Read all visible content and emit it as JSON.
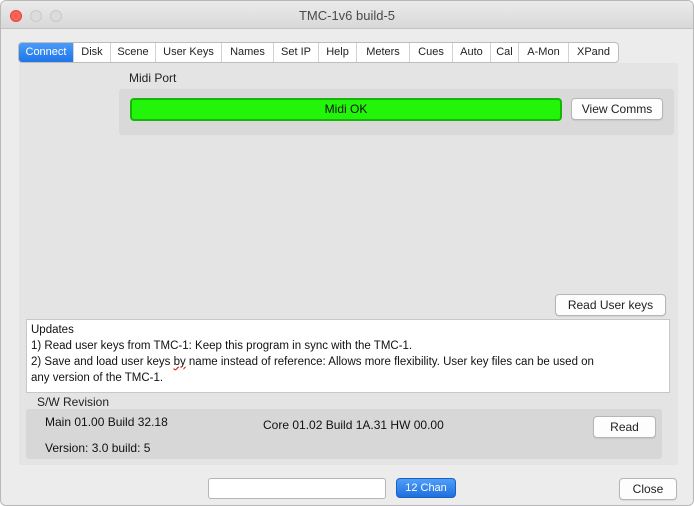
{
  "window": {
    "title": "TMC-1v6 build-5"
  },
  "tabs": [
    {
      "label": "Connect",
      "active": true
    },
    {
      "label": "Disk"
    },
    {
      "label": "Scene"
    },
    {
      "label": "User Keys"
    },
    {
      "label": "Names"
    },
    {
      "label": "Set IP"
    },
    {
      "label": "Help"
    },
    {
      "label": "Meters"
    },
    {
      "label": "Cues"
    },
    {
      "label": "Auto"
    },
    {
      "label": "Cal"
    },
    {
      "label": "A-Mon"
    },
    {
      "label": "XPand"
    }
  ],
  "midi": {
    "port_label": "Midi Port",
    "status": "Midi OK",
    "status_color": "#22f50a",
    "view_comms_label": "View Comms"
  },
  "read_user_keys_label": "Read User keys",
  "updates": {
    "heading": "Updates",
    "line1": "1) Read user keys from TMC-1: Keep this program in sync with the TMC-1.",
    "line2": "2) Save and load user keys by name instead of reference: Allows more flexibility. User key files can be used on",
    "line3": "any version of the TMC-1."
  },
  "sw_revision": {
    "label": "S/W Revision",
    "main": "Main 01.00 Build 32.18",
    "core": "Core 01.02 Build 1A.31 HW 00.00",
    "version": "Version: 3.0 build: 5",
    "read_label": "Read"
  },
  "footer": {
    "field_value": "",
    "chan_label": "12 Chan",
    "close_label": "Close"
  }
}
